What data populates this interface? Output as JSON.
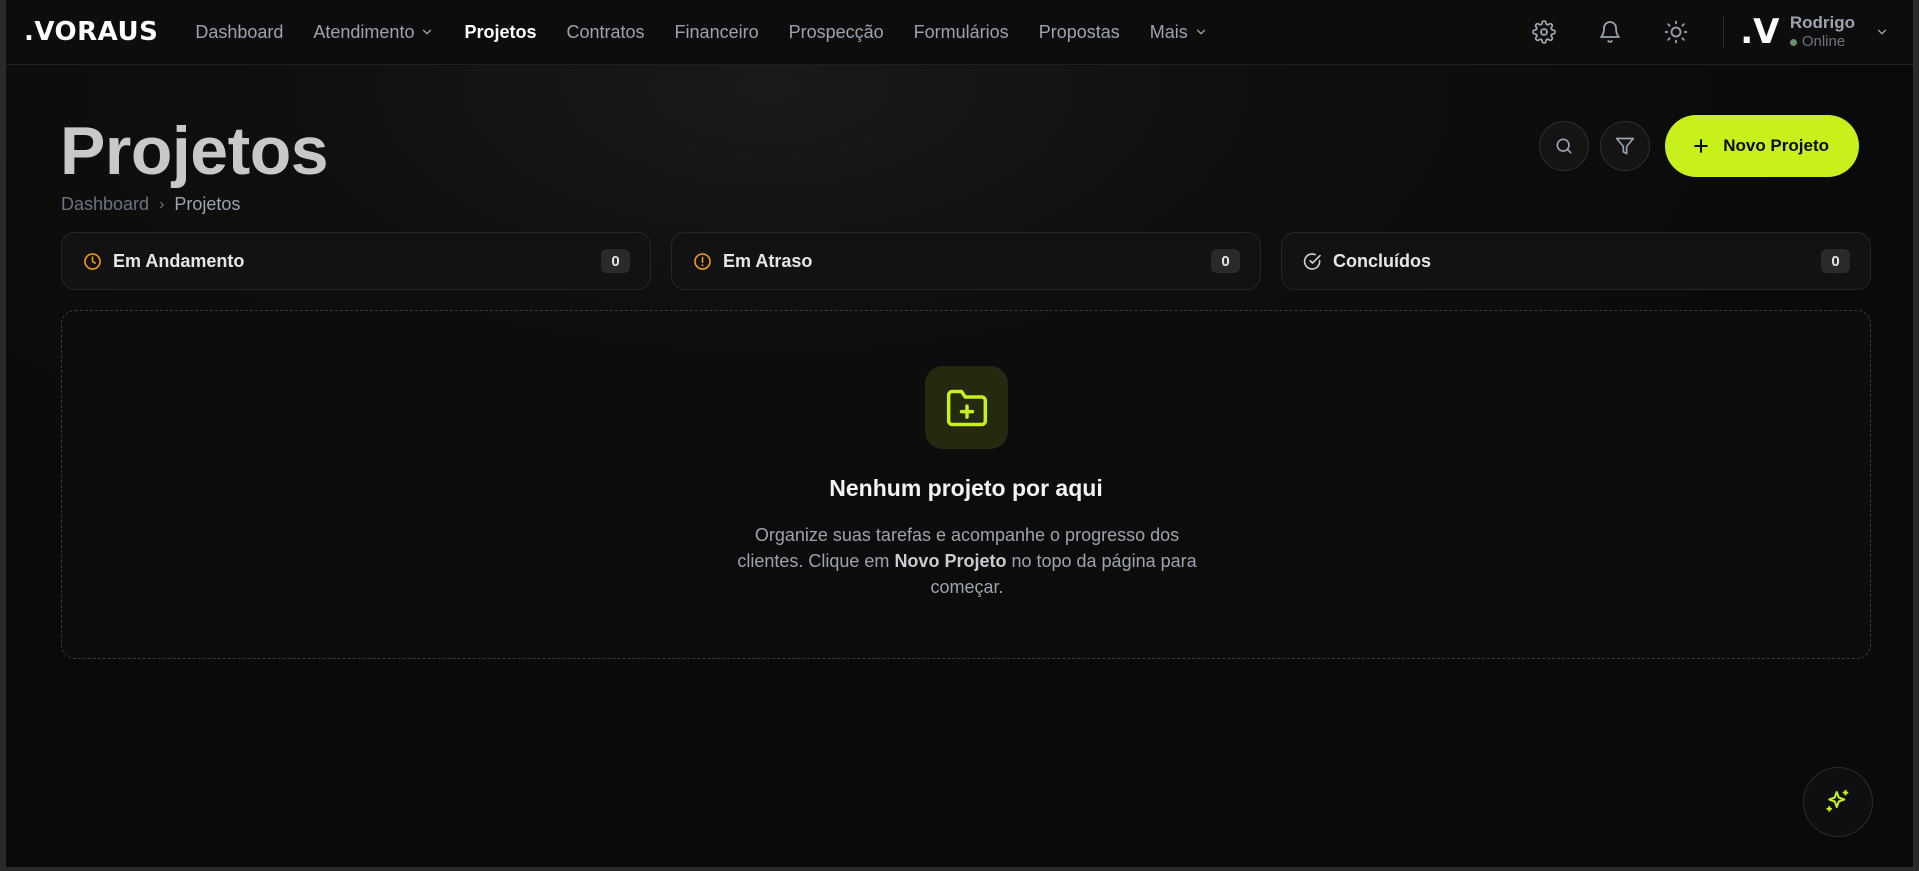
{
  "brand": ".VORAUS",
  "nav": {
    "items": [
      {
        "label": "Dashboard"
      },
      {
        "label": "Atendimento"
      },
      {
        "label": "Projetos"
      },
      {
        "label": "Contratos"
      },
      {
        "label": "Financeiro"
      },
      {
        "label": "Prospecção"
      },
      {
        "label": "Formulários"
      },
      {
        "label": "Propostas"
      },
      {
        "label": "Mais"
      }
    ],
    "active": "Projetos"
  },
  "user": {
    "avatar": ".V",
    "name": "Rodrigo",
    "status": "Online"
  },
  "header": {
    "title": "Projetos",
    "breadcrumb": [
      "Dashboard",
      "Projetos"
    ],
    "new_button": "Novo Projeto"
  },
  "stats": [
    {
      "label": "Em Andamento",
      "count": "0",
      "color": "#f59e0b"
    },
    {
      "label": "Em Atraso",
      "count": "0",
      "color": "#f59e0b"
    },
    {
      "label": "Concluídos",
      "count": "0",
      "color": "#d1d5db"
    }
  ],
  "empty_state": {
    "title": "Nenhum projeto por aqui",
    "text_before": "Organize suas tarefas e acompanhe o progresso dos clientes. Clique em",
    "text_bold": "Novo Projeto",
    "text_after": "no topo da página para começar."
  },
  "colors": {
    "accent": "#c8f01c",
    "background": "#0a0a0a"
  }
}
